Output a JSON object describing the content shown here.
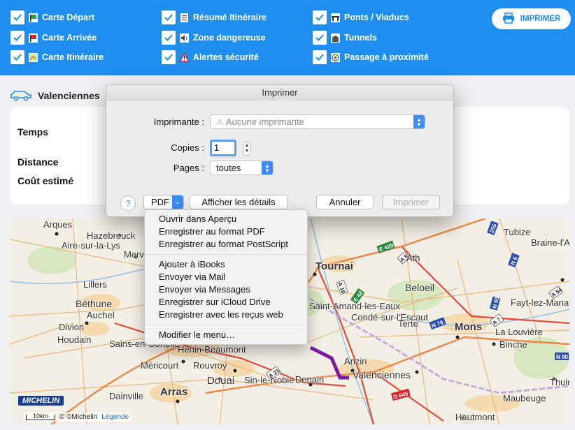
{
  "options": [
    {
      "label": "Carte Départ",
      "icon": "flag-green-icon"
    },
    {
      "label": "Carte Arrivée",
      "icon": "flag-red-icon"
    },
    {
      "label": "Carte Itinéraire",
      "icon": "map-icon"
    },
    {
      "label": "Résumé Itinéraire",
      "icon": "list-icon"
    },
    {
      "label": "Zone dangereuse",
      "icon": "speaker-icon"
    },
    {
      "label": "Alertes sécurité",
      "icon": "warning-icon"
    },
    {
      "label": "Ponts / Viaducs",
      "icon": "bridge-icon"
    },
    {
      "label": "Tunnels",
      "icon": "tunnel-icon"
    },
    {
      "label": "Passage à proximité",
      "icon": "target-icon"
    }
  ],
  "print_button": "IMPRIMER",
  "route": {
    "title": "Valenciennes"
  },
  "summary_labels": {
    "time": "Temps",
    "distance": "Distance",
    "cost": "Coût estimé"
  },
  "dialog": {
    "title": "Imprimer",
    "printer_label": "Imprimante :",
    "printer_value": "Aucune imprimante",
    "copies_label": "Copies :",
    "copies_value": "1",
    "pages_label": "Pages :",
    "pages_value": "toutes",
    "help": "?",
    "pdf": "PDF",
    "details": "Afficher les détails",
    "cancel": "Annuler",
    "print": "Imprimer"
  },
  "pdf_menu": {
    "group1": [
      "Ouvrir dans Aperçu",
      "Enregistrer au format PDF",
      "Enregistrer au format PostScript"
    ],
    "group2": [
      "Ajouter à iBooks",
      "Envoyer via Mail",
      "Envoyer via Messages",
      "Enregistrer sur iCloud Drive",
      "Enregistrer avec les reçus web"
    ],
    "group3": [
      "Modifier le menu…"
    ]
  },
  "map": {
    "places": [
      "Arques",
      "Hazebrouck",
      "Aire-sur-la-Lys",
      "Merv",
      "Lillers",
      "Béthune",
      "Auchel",
      "Divion",
      "Houdain",
      "Sains-en-Gohelle",
      "Méricourt",
      "Rouvroy",
      "Douai",
      "Sin-le-Noble",
      "Denain",
      "Anzin",
      "Valenciennes",
      "Dainville",
      "Arras",
      "Henin-Beaumont",
      "Tournai",
      "Ath",
      "Beloeil",
      "Saint-Amand-les-Eaux",
      "Condé-sur-l'Escaut",
      "Terte",
      "Mons",
      "La Louvière",
      "Binche",
      "Fayt-lez-Manage",
      "Braine-l'Alleud",
      "Tubize",
      "Maubeuge",
      "Hautmont",
      "Thuin"
    ],
    "road_badges": [
      "E 429",
      "A 8",
      "E 42",
      "A 16",
      "N 50",
      "N 55",
      "N 70",
      "E 19",
      "A 54",
      "D 649",
      "A 21",
      "N 90",
      "255",
      "N 6"
    ],
    "scale": "10km",
    "copyright": "© ©Michelin",
    "legend": "Légende",
    "brand": "MICHELIN"
  },
  "colors": {
    "accent": "#1e8ef0",
    "route": "#7a1aa0",
    "dialog_bg": "#ececec"
  }
}
